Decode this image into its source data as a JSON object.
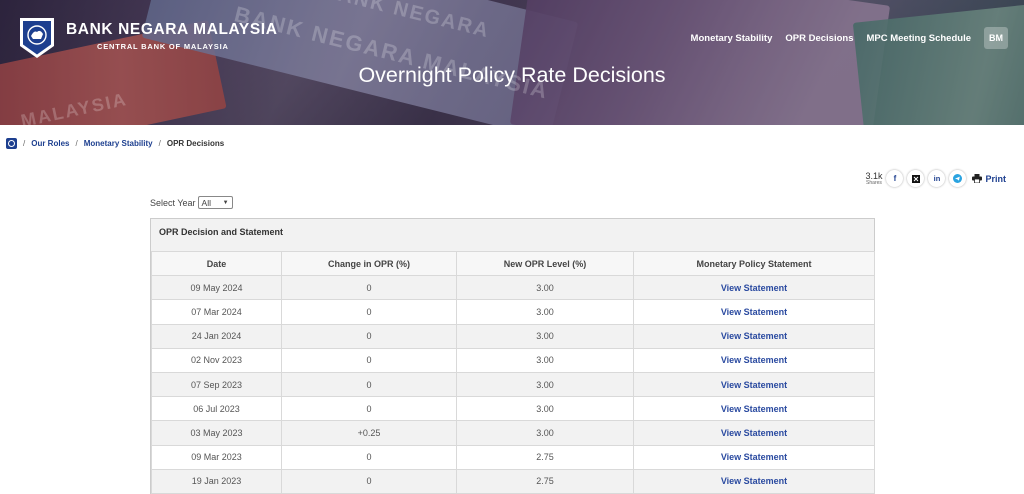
{
  "header": {
    "brand_name": "BANK NEGARA MALAYSIA",
    "brand_sub": "CENTRAL BANK OF MALAYSIA",
    "nav": [
      "Monetary Stability",
      "OPR Decisions",
      "MPC Meeting Schedule"
    ],
    "lang_button": "BM",
    "page_title": "Overnight Policy Rate Decisions",
    "banknote_text": [
      "BANK NEGARA MALAYSIA",
      "MALAYSIA",
      "BANK NEGARA"
    ]
  },
  "breadcrumb": {
    "items": [
      "Our Roles",
      "Monetary Stability"
    ],
    "current": "OPR Decisions"
  },
  "share": {
    "count": "3.1k",
    "count_label": "Shares",
    "icons": [
      "facebook-icon",
      "x-icon",
      "linkedin-icon",
      "telegram-icon"
    ],
    "print_label": "Print"
  },
  "filter": {
    "label": "Select Year",
    "selected": "All"
  },
  "table": {
    "title": "OPR Decision and Statement",
    "headers": [
      "Date",
      "Change in OPR (%)",
      "New OPR Level (%)",
      "Monetary Policy Statement"
    ],
    "rows": [
      {
        "date": "09 May 2024",
        "change": "0",
        "level": "3.00",
        "link": "View Statement"
      },
      {
        "date": "07 Mar 2024",
        "change": "0",
        "level": "3.00",
        "link": "View Statement"
      },
      {
        "date": "24 Jan 2024",
        "change": "0",
        "level": "3.00",
        "link": "View Statement"
      },
      {
        "date": "02 Nov 2023",
        "change": "0",
        "level": "3.00",
        "link": "View Statement"
      },
      {
        "date": "07 Sep 2023",
        "change": "0",
        "level": "3.00",
        "link": "View Statement"
      },
      {
        "date": "06 Jul 2023",
        "change": "0",
        "level": "3.00",
        "link": "View Statement"
      },
      {
        "date": "03 May 2023",
        "change": "+0.25",
        "level": "3.00",
        "link": "View Statement"
      },
      {
        "date": "09 Mar 2023",
        "change": "0",
        "level": "2.75",
        "link": "View Statement"
      },
      {
        "date": "19 Jan 2023",
        "change": "0",
        "level": "2.75",
        "link": "View Statement"
      }
    ]
  },
  "colors": {
    "brand_blue": "#1d3f8f",
    "link_blue": "#2a4aa0"
  }
}
